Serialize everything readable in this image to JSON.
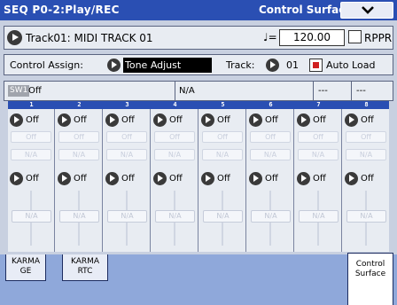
{
  "header": {
    "mode": "SEQ P0-2:Play/REC",
    "page": "Control Surface"
  },
  "track": {
    "name": "Track01: MIDI TRACK 01",
    "tempo_symbol": "♩=",
    "tempo": "120.00",
    "rppr_label": "RPPR"
  },
  "assign": {
    "label": "Control Assign:",
    "value": "Tone Adjust",
    "track_label": "Track:",
    "track_value": "01",
    "autoload_label": "Auto Load"
  },
  "sw": {
    "tag": "SW1",
    "value": "Off",
    "center": "N/A",
    "dash1": "---",
    "dash2": "---"
  },
  "channels": [
    {
      "num": "1",
      "sw1": "Off",
      "box": "Off",
      "na": "N/A",
      "sw2": "Off",
      "slider": "N/A"
    },
    {
      "num": "2",
      "sw1": "Off",
      "box": "Off",
      "na": "N/A",
      "sw2": "Off",
      "slider": "N/A"
    },
    {
      "num": "3",
      "sw1": "Off",
      "box": "Off",
      "na": "N/A",
      "sw2": "Off",
      "slider": "N/A"
    },
    {
      "num": "4",
      "sw1": "Off",
      "box": "Off",
      "na": "N/A",
      "sw2": "Off",
      "slider": "N/A"
    },
    {
      "num": "5",
      "sw1": "Off",
      "box": "Off",
      "na": "N/A",
      "sw2": "Off",
      "slider": "N/A"
    },
    {
      "num": "6",
      "sw1": "Off",
      "box": "Off",
      "na": "N/A",
      "sw2": "Off",
      "slider": "N/A"
    },
    {
      "num": "7",
      "sw1": "Off",
      "box": "Off",
      "na": "N/A",
      "sw2": "Off",
      "slider": "N/A"
    },
    {
      "num": "8",
      "sw1": "Off",
      "box": "Off",
      "na": "N/A",
      "sw2": "Off",
      "slider": "N/A"
    }
  ],
  "tabs": [
    {
      "line1": "KARMA",
      "line2": "GE"
    },
    {
      "line1": "KARMA",
      "line2": "RTC"
    },
    {
      "line1": "Control",
      "line2": "Surface"
    }
  ],
  "colors": {
    "title_bar": "#2a4fb3",
    "autoload_check": "#d02020"
  }
}
